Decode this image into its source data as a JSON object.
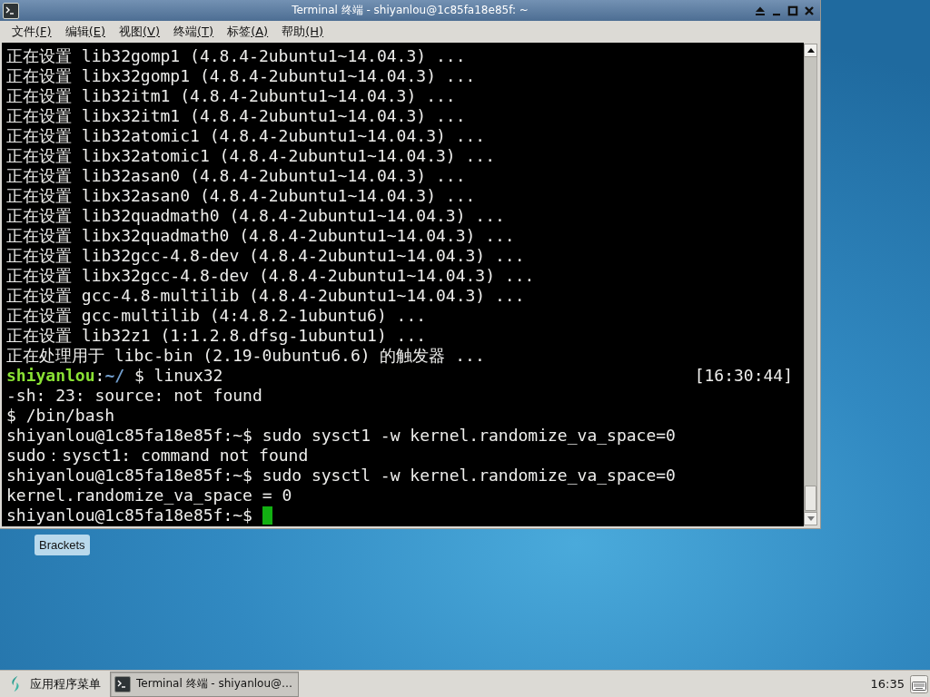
{
  "window": {
    "title": "Terminal 终端 - shiyanlou@1c85fa18e85f: ~"
  },
  "menu": [
    {
      "label": "文件",
      "accel": "(F)"
    },
    {
      "label": "编辑",
      "accel": "(E)"
    },
    {
      "label": "视图",
      "accel": "(V)"
    },
    {
      "label": "终端",
      "accel": "(T)"
    },
    {
      "label": "标签",
      "accel": "(A)"
    },
    {
      "label": "帮助",
      "accel": "(H)"
    }
  ],
  "terminal": {
    "lines": [
      {
        "kind": "output",
        "text": "正在设置 lib32gomp1 (4.8.4-2ubuntu1~14.04.3) ..."
      },
      {
        "kind": "output",
        "text": "正在设置 libx32gomp1 (4.8.4-2ubuntu1~14.04.3) ..."
      },
      {
        "kind": "output",
        "text": "正在设置 lib32itm1 (4.8.4-2ubuntu1~14.04.3) ..."
      },
      {
        "kind": "output",
        "text": "正在设置 libx32itm1 (4.8.4-2ubuntu1~14.04.3) ..."
      },
      {
        "kind": "output",
        "text": "正在设置 lib32atomic1 (4.8.4-2ubuntu1~14.04.3) ..."
      },
      {
        "kind": "output",
        "text": "正在设置 libx32atomic1 (4.8.4-2ubuntu1~14.04.3) ..."
      },
      {
        "kind": "output",
        "text": "正在设置 lib32asan0 (4.8.4-2ubuntu1~14.04.3) ..."
      },
      {
        "kind": "output",
        "text": "正在设置 libx32asan0 (4.8.4-2ubuntu1~14.04.3) ..."
      },
      {
        "kind": "output",
        "text": "正在设置 lib32quadmath0 (4.8.4-2ubuntu1~14.04.3) ..."
      },
      {
        "kind": "output",
        "text": "正在设置 libx32quadmath0 (4.8.4-2ubuntu1~14.04.3) ..."
      },
      {
        "kind": "output",
        "text": "正在设置 lib32gcc-4.8-dev (4.8.4-2ubuntu1~14.04.3) ..."
      },
      {
        "kind": "output",
        "text": "正在设置 libx32gcc-4.8-dev (4.8.4-2ubuntu1~14.04.3) ..."
      },
      {
        "kind": "output",
        "text": "正在设置 gcc-4.8-multilib (4.8.4-2ubuntu1~14.04.3) ..."
      },
      {
        "kind": "output",
        "text": "正在设置 gcc-multilib (4:4.8.2-1ubuntu6) ..."
      },
      {
        "kind": "output",
        "text": "正在设置 lib32z1 (1:1.2.8.dfsg-1ubuntu1) ..."
      },
      {
        "kind": "output",
        "text": "正在处理用于 libc-bin (2.19-0ubuntu6.6) 的触发器 ..."
      },
      {
        "kind": "prompt",
        "user": "shiyanlou",
        "separator": ":",
        "path": "~/",
        "command": " $ linux32",
        "time": "[16:30:44]"
      },
      {
        "kind": "output",
        "text": "-sh: 23: source: not found"
      },
      {
        "kind": "output",
        "text": "$ /bin/bash"
      },
      {
        "kind": "output",
        "text": "shiyanlou@1c85fa18e85f:~$ sudo sysct1 -w kernel.randomize_va_space=0"
      },
      {
        "kind": "output",
        "text": "sudo：sysct1: command not found"
      },
      {
        "kind": "output",
        "text": "shiyanlou@1c85fa18e85f:~$ sudo sysctl -w kernel.randomize_va_space=0"
      },
      {
        "kind": "output",
        "text": "kernel.randomize_va_space = 0"
      },
      {
        "kind": "input",
        "text": "shiyanlou@1c85fa18e85f:~$",
        "cursor": true
      }
    ]
  },
  "desktop_icons": [
    {
      "label": "Brackets"
    }
  ],
  "taskbar": {
    "app_menu": "应用程序菜单",
    "tasks": [
      {
        "label": "Terminal 终端 - shiyanlou@…",
        "selected": true
      }
    ],
    "clock": "16:35"
  }
}
